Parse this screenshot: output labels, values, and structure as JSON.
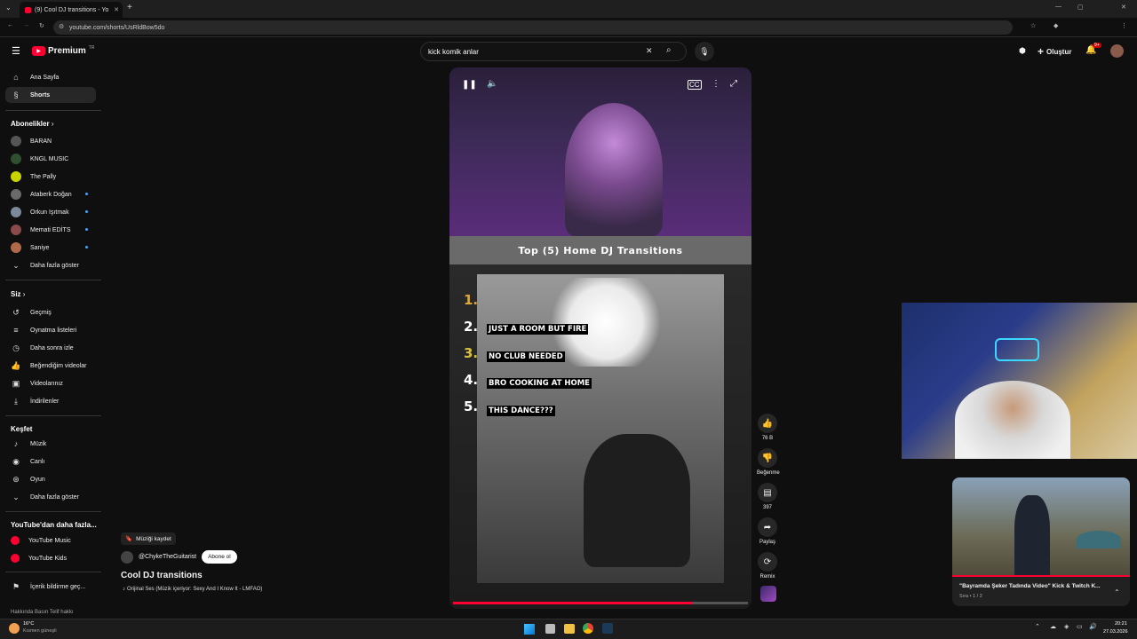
{
  "browser": {
    "tab_title": "(9) Cool DJ transitions - Yo",
    "url": "youtube.com/shorts/UsRldBow5do"
  },
  "masthead": {
    "logo_text": "Premium",
    "logo_sup": "TR",
    "search_value": "kick komik anlar",
    "create_label": "Oluştur",
    "notif_count": "9+"
  },
  "sidebar": {
    "home": "Ana Sayfa",
    "shorts": "Shorts",
    "subs_header": "Abonelikler",
    "subs": [
      "BARAN",
      "KNGL MUSIC",
      "The Pally",
      "Ataberk Doğan",
      "Orkun Işıtmak",
      "Memati EDİTS",
      "Saniye"
    ],
    "more1": "Daha fazla göster",
    "you_header": "Siz",
    "you": [
      "Geçmiş",
      "Oynatma listeleri",
      "Daha sonra izle",
      "Beğendiğim videolar",
      "Videolarınız",
      "İndirilenler"
    ],
    "explore_header": "Keşfet",
    "explore": [
      "Müzik",
      "Canlı",
      "Oyun"
    ],
    "more2": "Daha fazla göster",
    "more_yt_header": "YouTube'dan daha fazla...",
    "more_yt": [
      "YouTube Music",
      "YouTube Kids"
    ],
    "report": "İçerik bildirme geç...",
    "footer": "Hakkında  Basın  Telif hakkı"
  },
  "video": {
    "banner": "Top (5) Home DJ Transitions",
    "ranks": [
      "1.",
      "2.",
      "3.",
      "4.",
      "5."
    ],
    "items": [
      "",
      "JUST A ROOM BUT FIRE",
      "NO CLUB NEEDED",
      "BRO COOKING AT HOME",
      "THIS DANCE???"
    ],
    "progress": 0.81
  },
  "actions": {
    "likes": "76 B",
    "dislike": "Beğenme",
    "comments": "397",
    "share": "Paylaş",
    "remix": "Remix"
  },
  "info": {
    "save_music": "Müziği kaydet",
    "channel": "@ChykeTheGuitarist",
    "subscribe": "Abone ol",
    "title": "Cool DJ transitions",
    "sound": "Orijinal Ses (Müzik içeriyor: Sexy And I Know It - LMFAO)"
  },
  "mini": {
    "title": "\"Bayramda Şeker Tadında Video\" Kick & Twitch K...",
    "queue": "Sıra • 1 / 2"
  },
  "taskbar": {
    "temp": "16°C",
    "weather": "Kısmen güneşli",
    "time": "20:21",
    "date": "27.03.2026"
  },
  "colors": {
    "accent": "#ff0033",
    "link": "#3ea6ff"
  }
}
